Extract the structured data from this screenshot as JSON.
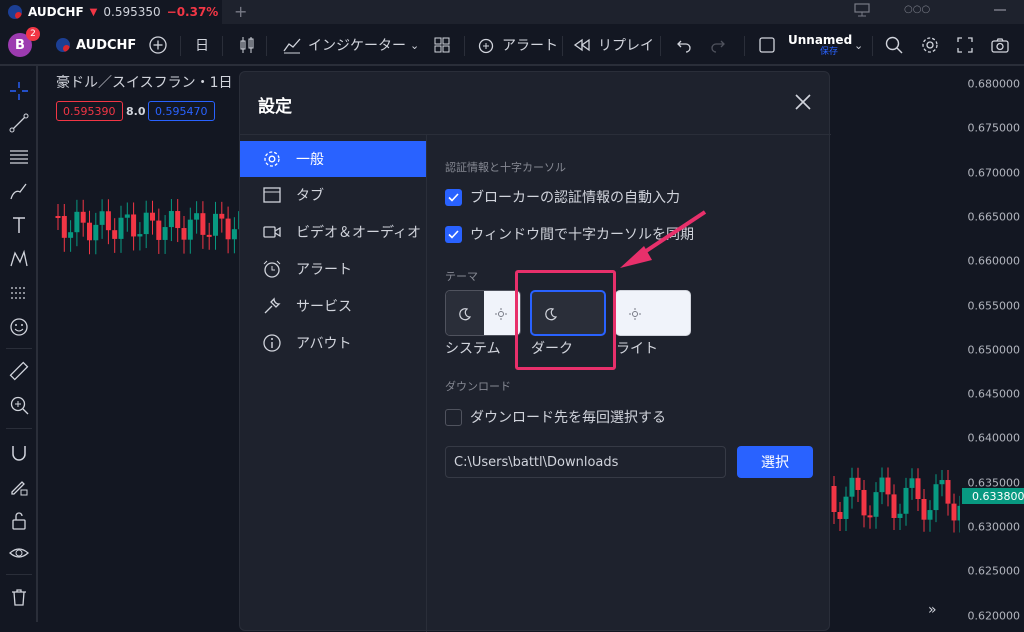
{
  "tab": {
    "symbol": "AUDCHF",
    "arrow": "▼",
    "price": "0.595350",
    "change": "−0.37%",
    "new_tab": "+"
  },
  "window": {
    "icons": [
      "pin-icon",
      "more-icon",
      "minimize-icon"
    ],
    "more": "○○○"
  },
  "toolbar": {
    "avatar_letter": "B",
    "notification_count": "2",
    "symbol": "AUDCHF",
    "interval": "日",
    "indicators": "インジケーター",
    "alert": "アラート",
    "replay": "リプレイ",
    "layout_name": "Unnamed",
    "save_label": "保存"
  },
  "chart": {
    "title": "豪ドル／スイスフラン・1日",
    "bid": "0.595390",
    "spread": "8.0",
    "ask": "0.595470",
    "y_ticks": [
      "0.680000",
      "0.675000",
      "0.670000",
      "0.665000",
      "0.660000",
      "0.655000",
      "0.650000",
      "0.645000",
      "0.640000",
      "0.635000",
      "0.630000",
      "0.625000",
      "0.620000"
    ],
    "current_price": "0.633800",
    "colors": {
      "up": "#089981",
      "down": "#f23645",
      "accent": "#2962ff"
    }
  },
  "dialog": {
    "title": "設定",
    "nav": [
      {
        "label": "一般",
        "icon": "gear-icon",
        "active": true
      },
      {
        "label": "タブ",
        "icon": "tab-icon"
      },
      {
        "label": "ビデオ＆オーディオ",
        "icon": "video-icon"
      },
      {
        "label": "アラート",
        "icon": "alarm-clock-icon"
      },
      {
        "label": "サービス",
        "icon": "wrench-icon"
      },
      {
        "label": "アバウト",
        "icon": "info-icon"
      }
    ],
    "section_auth": "認証情報と十字カーソル",
    "check_autofill": "ブローカーの認証情報の自動入力",
    "check_sync": "ウィンドウ間で十字カーソルを同期",
    "section_theme": "テーマ",
    "themes": [
      {
        "label": "システム"
      },
      {
        "label": "ダーク",
        "selected": true
      },
      {
        "label": "ライト"
      }
    ],
    "section_download": "ダウンロード",
    "check_ask_download": "ダウンロード先を毎回選択する",
    "download_path": "C:\\Users\\battl\\Downloads",
    "select_button": "選択"
  }
}
